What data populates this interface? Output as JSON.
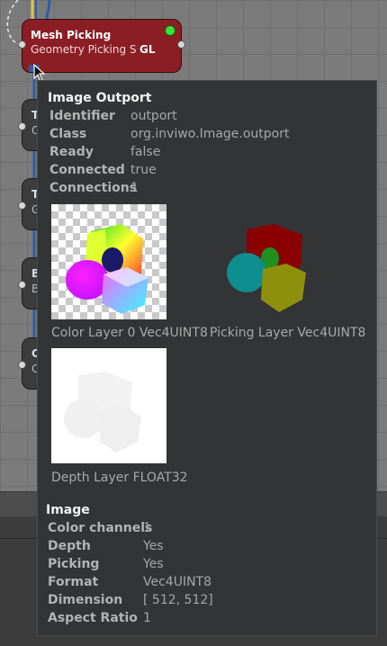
{
  "processor": {
    "title": "Mesh Picking",
    "subtitle": "Geometry Picking S",
    "badge": "GL",
    "status_color": "#39e23a",
    "color": "#8b1e24"
  },
  "background_processors": [
    {
      "title_glyph": "T",
      "sub_glyph": "O"
    },
    {
      "title_glyph": "T",
      "sub_glyph": "G"
    },
    {
      "title_glyph": "B",
      "sub_glyph": "B"
    },
    {
      "title_glyph": "C",
      "sub_glyph": "C"
    }
  ],
  "tooltip": {
    "port_heading": "Image Outport",
    "port_props": [
      {
        "key": "Identifier",
        "value": "outport"
      },
      {
        "key": "Class",
        "value": "org.inviwo.Image.outport"
      },
      {
        "key": "Ready",
        "value": "false"
      },
      {
        "key": "Connected",
        "value": "true"
      },
      {
        "key": "Connections",
        "value": "1"
      }
    ],
    "layers": [
      {
        "label": "Color Layer 0 Vec4UINT8"
      },
      {
        "label": "Picking Layer Vec4UINT8"
      },
      {
        "label": "Depth Layer FLOAT32"
      }
    ],
    "image_heading": "Image",
    "image_props": [
      {
        "key": "Color channels",
        "value": "1"
      },
      {
        "key": "Depth",
        "value": "Yes"
      },
      {
        "key": "Picking",
        "value": "Yes"
      },
      {
        "key": "Format",
        "value": "Vec4UINT8"
      },
      {
        "key": "Dimension",
        "value": "[ 512, 512]"
      },
      {
        "key": "Aspect Ratio",
        "value": "1"
      }
    ]
  }
}
